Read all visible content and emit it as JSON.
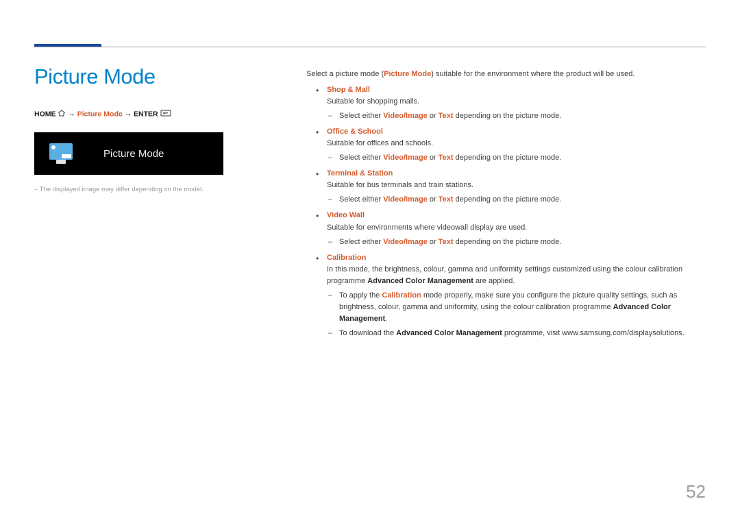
{
  "page": {
    "title": "Picture Mode",
    "number": "52"
  },
  "breadcrumb": {
    "home": "HOME",
    "arrow1": " → ",
    "mid": "Picture Mode",
    "arrow2": " → ",
    "enter": "ENTER"
  },
  "preview": {
    "label": "Picture Mode"
  },
  "image_note_prefix": "‒  ",
  "image_note": "The displayed image may differ depending on the model.",
  "intro": {
    "pre": "Select a picture mode (",
    "highlight": "Picture Mode",
    "post": ") suitable for the environment where the product will be used."
  },
  "select_line": {
    "pre": "Select either ",
    "opt1": "Video/Image",
    "mid": " or ",
    "opt2": "Text",
    "post": " depending on the picture mode."
  },
  "modes": {
    "shop": {
      "name": "Shop & Mall",
      "desc": "Suitable for shopping malls."
    },
    "office": {
      "name": "Office & School",
      "desc": "Suitable for offices and schools."
    },
    "terminal": {
      "name": "Terminal & Station",
      "desc": "Suitable for bus terminals and train stations."
    },
    "videowall": {
      "name": "Video Wall",
      "desc": "Suitable for environments where videowall display are used."
    },
    "calibration": {
      "name": "Calibration",
      "desc_pre": "In this mode, the brightness, colour, gamma and uniformity settings customized using the colour calibration programme ",
      "acm": "Advanced Color Management",
      "desc_post": " are applied.",
      "note1_pre": "To apply the ",
      "note1_cal": "Calibration",
      "note1_mid": " mode properly, make sure you configure the picture quality settings, such as brightness, colour, gamma and uniformity, using the colour calibration programme ",
      "note1_post": ".",
      "note2_pre": "To download the ",
      "note2_post": " programme, visit www.samsung.com/displaysolutions."
    }
  }
}
